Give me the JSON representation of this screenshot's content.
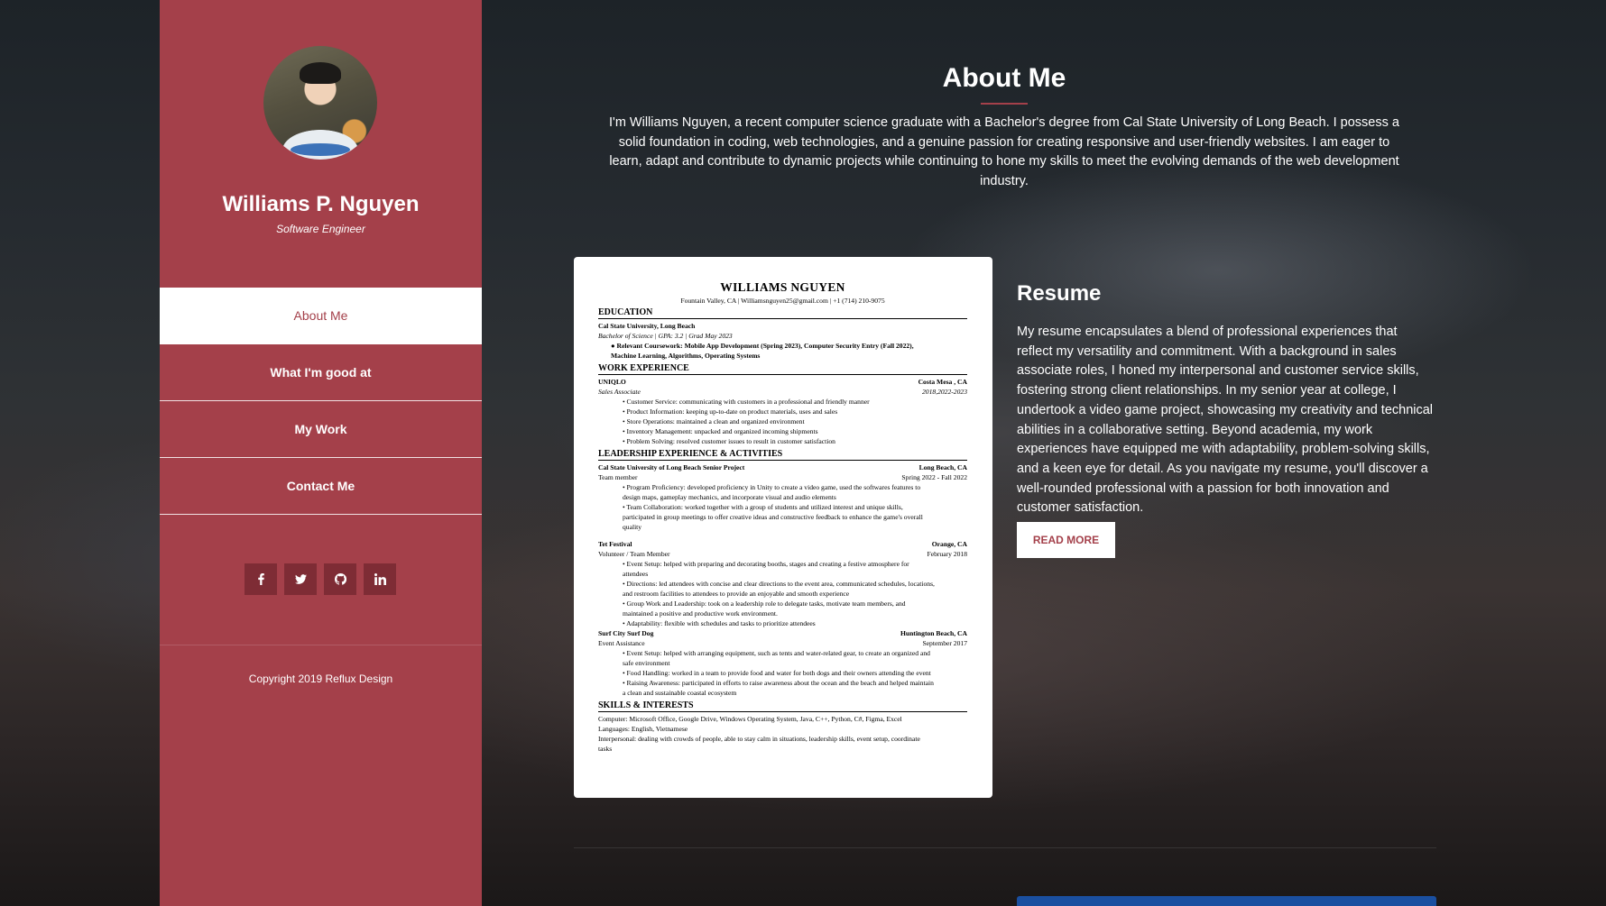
{
  "sidebar": {
    "name": "Williams P. Nguyen",
    "role": "Software Engineer",
    "nav": [
      {
        "label": "About Me",
        "active": true
      },
      {
        "label": "What I'm good at",
        "active": false
      },
      {
        "label": "My Work",
        "active": false
      },
      {
        "label": "Contact Me",
        "active": false
      }
    ],
    "socials": [
      "facebook-icon",
      "twitter-icon",
      "github-icon",
      "linkedin-icon"
    ],
    "copyright": "Copyright 2019 Reflux Design"
  },
  "about": {
    "title": "About Me",
    "intro": "I'm Williams Nguyen, a recent computer science graduate with a Bachelor's degree from Cal State University of Long Beach. I possess a solid foundation in coding, web technologies, and a genuine passion for creating responsive and user-friendly websites. I am eager to learn, adapt and contribute to dynamic projects while continuing to hone my skills to meet the evolving demands of the web development industry."
  },
  "resume": {
    "heading": "Resume",
    "text": "My resume encapsulates a blend of professional experiences that reflect my versatility and commitment. With a background in sales associate roles, I honed my interpersonal and customer service skills, fostering strong client relationships. In my senior year at college, I undertook a video game project, showcasing my creativity and technical abilities in a collaborative setting. Beyond academia, my work experiences have equipped me with adaptability, problem-solving skills, and a keen eye for detail. As you navigate my resume, you'll discover a well-rounded professional with a passion for both innovation and customer satisfaction.",
    "button": "READ MORE",
    "document": {
      "name": "WILLIAMS NGUYEN",
      "contact": "Fountain Valley, CA | Williamsnguyen25@gmail.com | +1 (714) 210-9075",
      "education_h": "EDUCATION",
      "school": "Cal State University, Long Beach",
      "degree": "Bachelor of Science | GPA: 3.2 | Grad May 2023",
      "coursework": "Relevant Coursework: Mobile App Development (Spring 2023), Computer Security Entry (Fall 2022),",
      "coursework2": "Machine Learning, Algorithms, Operating Systems",
      "work_h": "WORK EXPERIENCE",
      "job1": "UNIQLO",
      "job1_loc": "Costa Mesa , CA",
      "job1_role": "Sales Associate",
      "job1_date": "2018,2022-2023",
      "job1_bullets": [
        "• Customer Service: communicating with customers in a professional and friendly manner",
        "• Product Information: keeping up-to-date on product materials, uses and sales",
        "• Store Operations: maintained a clean and organized environment",
        "• Inventory Management: unpacked and organized incoming shipments",
        "• Problem Solving: resolved customer issues to result in customer satisfaction"
      ],
      "lead_h": "LEADERSHIP EXPERIENCE & ACTIVITIES",
      "lead1": "Cal State University of Long Beach Senior Project",
      "lead1_loc": "Long Beach, CA",
      "lead1_role": "Team member",
      "lead1_date": "Spring 2022 - Fall 2022",
      "lead1_bullets": [
        "• Program Proficiency: developed proficiency in Unity to create a video game, used the softwares features to",
        "design maps, gameplay mechanics, and incorporate visual and audio elements",
        "• Team Collaboration: worked together with a group of students and utilized interest and unique skills,",
        "participated in group meetings to offer creative ideas and constructive feedback to enhance the game's overall",
        "quality"
      ],
      "lead2": "Tet Festival",
      "lead2_loc": "Orange, CA",
      "lead2_role": "Volunteer / Team Member",
      "lead2_date": "February 2018",
      "lead2_bullets": [
        "• Event Setup: helped with preparing and decorating booths, stages and creating a festive atmosphere for",
        "attendees",
        "• Directions: led attendees with concise and clear directions to the event area, communicated schedules, locations,",
        "and restroom facilities to attendees to provide an enjoyable and smooth experience",
        "• Group Work and Leadership: took on a leadership role to delegate tasks, motivate team members, and",
        "maintained a positive and productive work environment.",
        "• Adaptability: flexible with schedules and tasks to prioritize attendees"
      ],
      "lead3": "Surf City Surf Dog",
      "lead3_loc": "Huntington Beach, CA",
      "lead3_role": "Event Assistance",
      "lead3_date": "September 2017",
      "lead3_bullets": [
        "• Event Setup: helped with arranging equipment, such as tents and water-related gear, to create an organized and",
        "safe environment",
        "• Food Handling: worked in a team to provide food and water for both dogs and their owners attending the event",
        "• Raising Awareness: participated in efforts to raise awareness about the ocean and the beach and helped maintain",
        "a clean and sustainable coastal ecosystem"
      ],
      "skills_h": "SKILLS & INTERESTS",
      "skills": [
        "Computer: Microsoft Office, Google Drive, Windows Operating System, Java, C++, Python, C#, Figma, Excel",
        "Languages: English, Vietnamese",
        "Interpersonal: dealing with crowds of people, able to stay calm in situations, leadership skills, event setup, coordinate",
        "tasks"
      ]
    }
  }
}
